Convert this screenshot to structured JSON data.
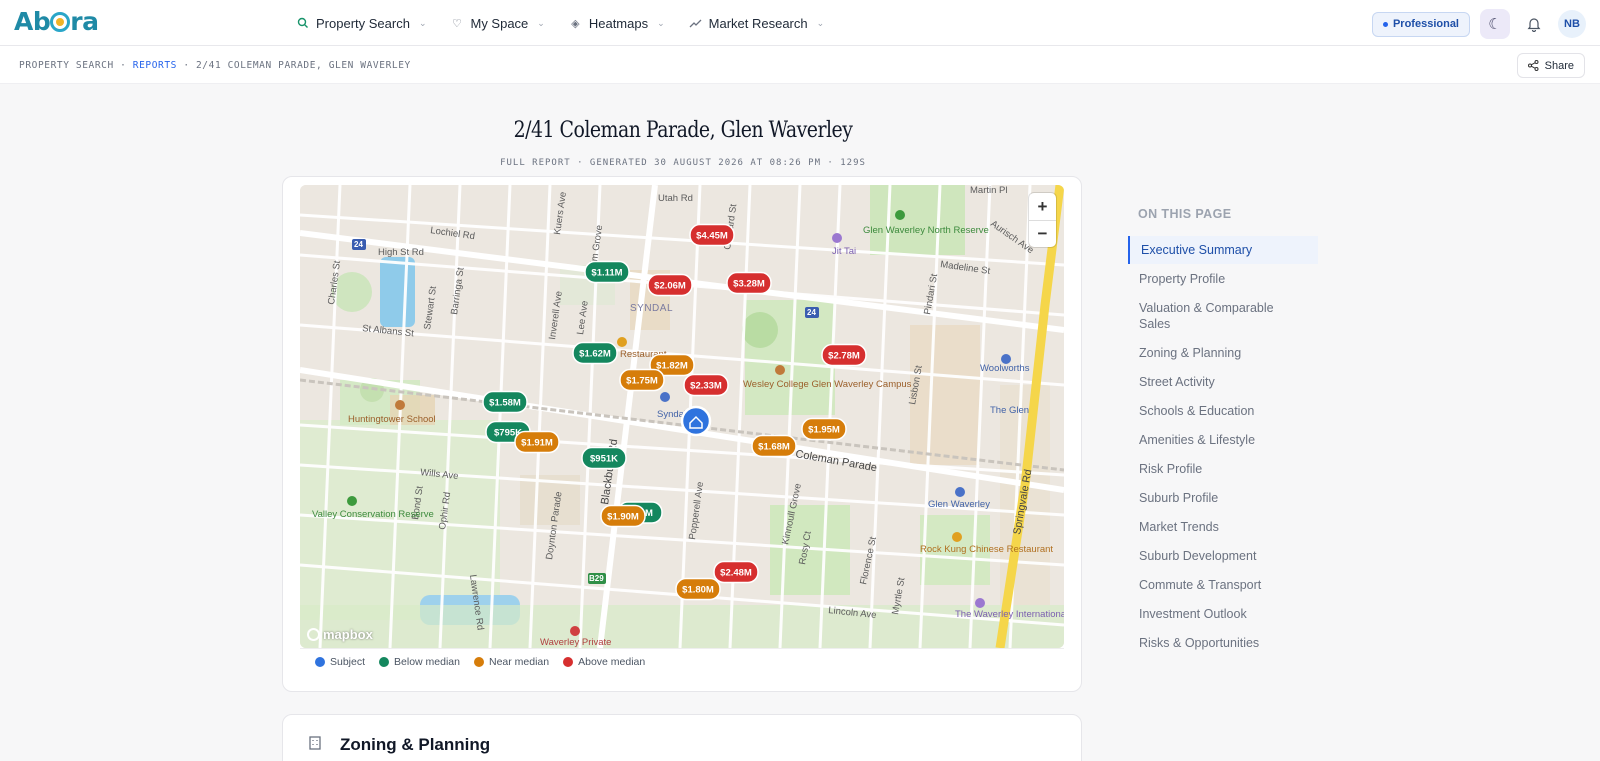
{
  "app": {
    "logo": "Abora",
    "nav": [
      {
        "label": "Property Search",
        "icon": "search-icon"
      },
      {
        "label": "My Space",
        "icon": "heart-icon"
      },
      {
        "label": "Heatmaps",
        "icon": "layers-icon"
      },
      {
        "label": "Market Research",
        "icon": "trend-icon"
      }
    ],
    "plan_badge": "Professional",
    "user_initials": "NB"
  },
  "breadcrumb": {
    "root": "PROPERTY SEARCH",
    "section": "REPORTS",
    "current": "2/41 COLEMAN PARADE, GLEN WAVERLEY"
  },
  "share_label": "Share",
  "report": {
    "title": "2/41 Coleman Parade, Glen Waverley",
    "subtitle": "FULL REPORT · GENERATED 30 AUGUST 2026 AT 08:26 PM · 129S"
  },
  "map": {
    "attribution": "mapbox",
    "zoom_in": "+",
    "zoom_out": "−",
    "colors": {
      "subject": "#2f73de",
      "below": "#14875e",
      "near": "#d67d0a",
      "above": "#d62f2f"
    },
    "streets": [
      "High St Rd",
      "Lochiel Rd",
      "Utah Rd",
      "Martin Pl",
      "St Albans St",
      "Coleman Parade",
      "Wills Ave",
      "Lincoln Ave",
      "Blackburn Rd",
      "Springvale Rd",
      "Madeline St",
      "Kinnoull Grove",
      "Florence St",
      "Popperell Ave",
      "Rosy Ct",
      "Myrtle St",
      "Lisbon St",
      "Pindari St",
      "Aurisch Ave",
      "Orchard St",
      "Elm Grove",
      "Lee Ave",
      "Inverell Ave",
      "Bond St",
      "Ophir Rd",
      "Lawrence Rd",
      "Doynton Parade",
      "Stewart St",
      "Barringa St",
      "Kuers Ave",
      "Charles St"
    ],
    "places": [
      "SYNDAL",
      "Glen Waverley North Reserve",
      "Jit Tai",
      "Wesley College Glen Waverley Campus",
      "Woolworths",
      "The Glen",
      "Huntingtower School",
      "Valley Conservation Reserve",
      "Glen Waverley",
      "Rock Kung Chinese Restaurant",
      "The Waverley International Hotel",
      "Waverley Private",
      "Syndal",
      "Restaurant"
    ],
    "markers": [
      {
        "label": "$4.45M",
        "cat": "above"
      },
      {
        "label": "$1.11M",
        "cat": "below"
      },
      {
        "label": "$2.06M",
        "cat": "above"
      },
      {
        "label": "$3.28M",
        "cat": "above"
      },
      {
        "label": "$1.62M",
        "cat": "below"
      },
      {
        "label": "$2.78M",
        "cat": "above"
      },
      {
        "label": "$1.82M",
        "cat": "near"
      },
      {
        "label": "$1.75M",
        "cat": "near"
      },
      {
        "label": "$2.33M",
        "cat": "above"
      },
      {
        "label": "$1.58M",
        "cat": "below"
      },
      {
        "label": "$1.95M",
        "cat": "near"
      },
      {
        "label": "$795K",
        "cat": "below"
      },
      {
        "label": "$1.91M",
        "cat": "near"
      },
      {
        "label": "$1.68M",
        "cat": "near"
      },
      {
        "label": "$951K",
        "cat": "below"
      },
      {
        "label": "$1.90M",
        "cat": "near"
      },
      {
        "label": "$2.48M",
        "cat": "above"
      },
      {
        "label": "$1.80M",
        "cat": "near"
      }
    ],
    "hidden_marker_label": "M",
    "route_labels": [
      "24",
      "24",
      "B29"
    ]
  },
  "legend": [
    {
      "label": "Subject",
      "color": "#2f73de"
    },
    {
      "label": "Below median",
      "color": "#14875e"
    },
    {
      "label": "Near median",
      "color": "#d67d0a"
    },
    {
      "label": "Above median",
      "color": "#d62f2f"
    }
  ],
  "zoning": {
    "title": "Zoning & Planning"
  },
  "toc": {
    "heading": "ON THIS PAGE",
    "items": [
      "Executive Summary",
      "Property Profile",
      "Valuation & Comparable Sales",
      "Zoning & Planning",
      "Street Activity",
      "Schools & Education",
      "Amenities & Lifestyle",
      "Risk Profile",
      "Suburb Profile",
      "Market Trends",
      "Suburb Development",
      "Commute & Transport",
      "Investment Outlook",
      "Risks & Opportunities"
    ]
  }
}
